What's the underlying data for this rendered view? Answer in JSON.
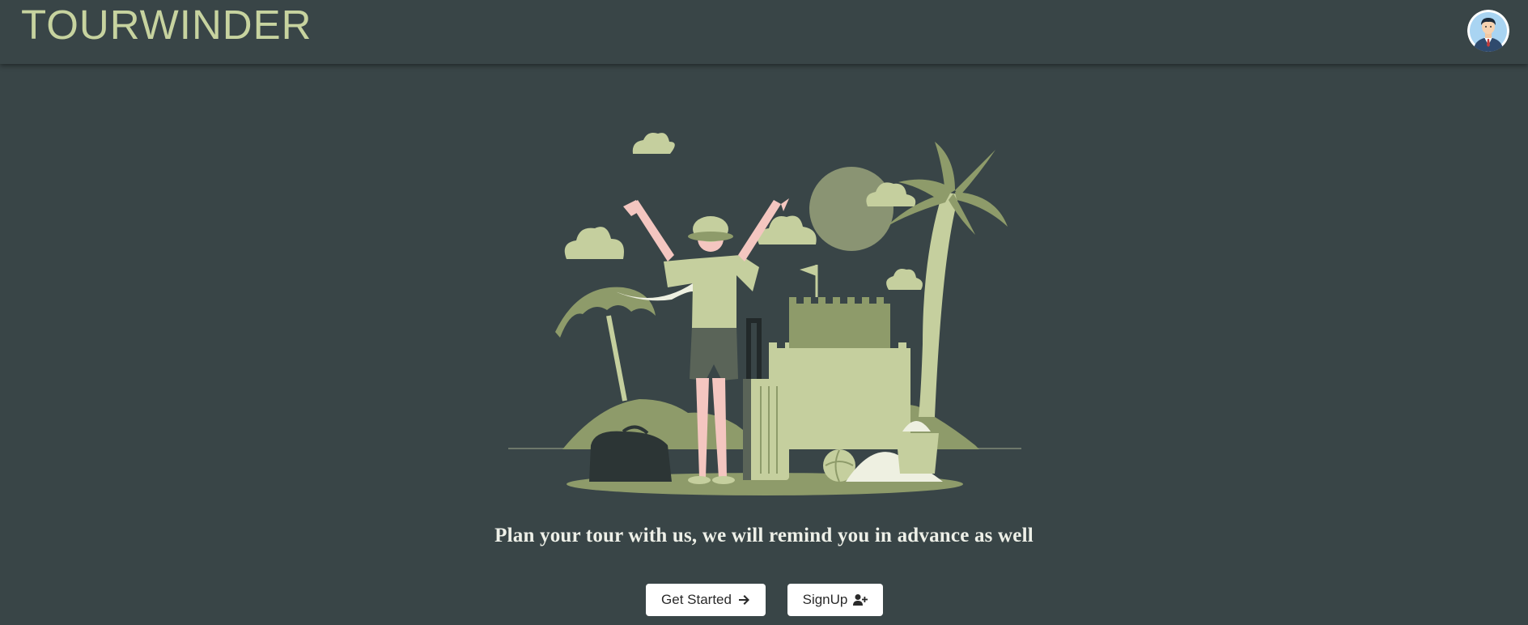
{
  "header": {
    "brand": "TOURWINDER",
    "avatar_icon": "user-avatar-icon"
  },
  "hero": {
    "illustration": "traveler-beach-illustration",
    "tagline": "Plan your tour with us, we will remind you in advance as well"
  },
  "actions": {
    "get_started_label": "Get Started",
    "get_started_icon": "arrow-right-icon",
    "signup_label": "SignUp",
    "signup_icon": "user-plus-icon"
  },
  "colors": {
    "background": "#394547",
    "brand": "#c7d39f",
    "button_bg": "#ffffff"
  }
}
